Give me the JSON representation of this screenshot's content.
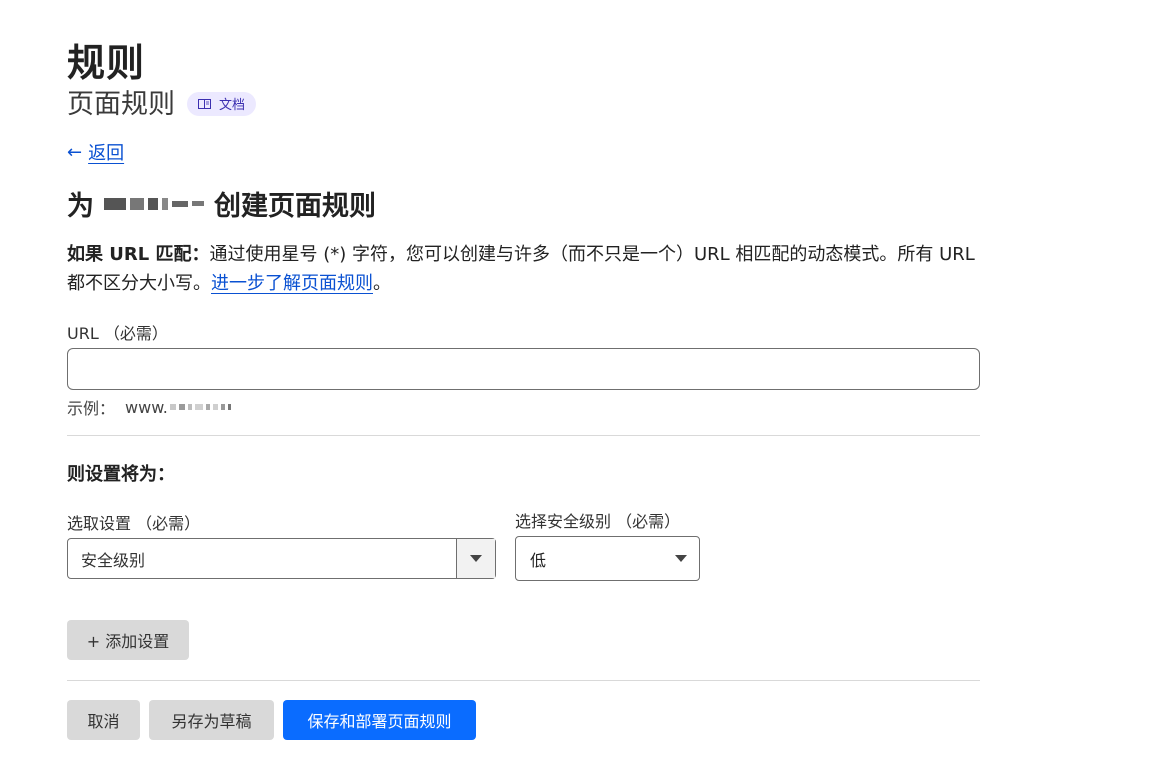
{
  "header": {
    "title": "规则",
    "subtitle": "页面规则",
    "doc_badge": "文档"
  },
  "nav": {
    "back_arrow": "←",
    "back_label": "返回"
  },
  "form": {
    "title_prefix": "为",
    "title_suffix": "创建页面规则",
    "desc_bold": "如果 URL 匹配：",
    "desc_text": "通过使用星号 (*) 字符，您可以创建与许多（而不只是一个）URL 相匹配的动态模式。所有 URL 都不区分大小写。",
    "desc_link": "进一步了解页面规则",
    "desc_end": "。",
    "url_label": "URL （必需）",
    "url_value": "",
    "example_label": "示例：",
    "example_prefix": "www."
  },
  "settings": {
    "section_title": "则设置将为：",
    "setting_label": "选取设置 （必需）",
    "setting_value": "安全级别",
    "level_label": "选择安全级别 （必需）",
    "level_value": "低",
    "add_setting": "+ 添加设置"
  },
  "actions": {
    "cancel": "取消",
    "save_draft": "另存为草稿",
    "save_deploy": "保存和部署页面规则"
  },
  "colors": {
    "link": "#0a51d2",
    "primary": "#0a6cff",
    "badge_bg": "#ece9ff",
    "grey_button": "#d9d9d9"
  }
}
